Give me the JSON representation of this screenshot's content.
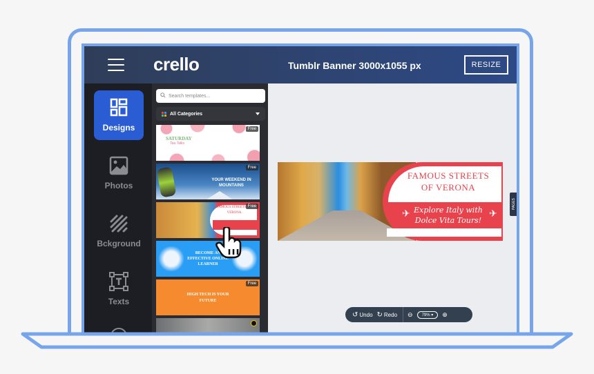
{
  "topbar": {
    "logo": "crello",
    "document_title": "Tumblr Banner 3000x1055 px",
    "resize_label": "RESIZE",
    "menu_icon": "hamburger-icon"
  },
  "rail": {
    "items": [
      {
        "label": "Designs",
        "icon": "grid-icon",
        "active": true
      },
      {
        "label": "Photos",
        "icon": "image-icon",
        "active": false
      },
      {
        "label": "Bckground",
        "icon": "stripes-icon",
        "active": false
      },
      {
        "label": "Texts",
        "icon": "text-box-icon",
        "active": false
      }
    ]
  },
  "panel": {
    "search_placeholder": "Search templates...",
    "category": "All Categories",
    "templates": [
      {
        "title": "SATURDAY",
        "subtitle": "Tea Talks",
        "badge": "Free"
      },
      {
        "title": "YOUR WEEKEND IN MOUNTAINS",
        "badge": "Free"
      },
      {
        "title": "FAMOUS STREETS OF VERONA",
        "badge": "Free"
      },
      {
        "title": "BECOME AN EFFECTIVE ONLINE LEARNER",
        "badge": ""
      },
      {
        "title": "HIGH TECH IS YOUR FUTURE",
        "badge": "Free"
      },
      {
        "title": "",
        "badge": ""
      }
    ]
  },
  "canvas": {
    "banner": {
      "headline_line1": "FAMOUS STREETS",
      "headline_line2": "OF VERONA",
      "script_line1": "Explore Italy with",
      "script_line2": "Dolce Vita Tours!"
    },
    "pages_tab": "PAGES"
  },
  "toolbar": {
    "undo_label": "Undo",
    "redo_label": "Redo",
    "zoom_value": "79%"
  },
  "colors": {
    "accent": "#2a5dd4",
    "frame": "#76a5ea",
    "banner_red": "#e8424c"
  }
}
